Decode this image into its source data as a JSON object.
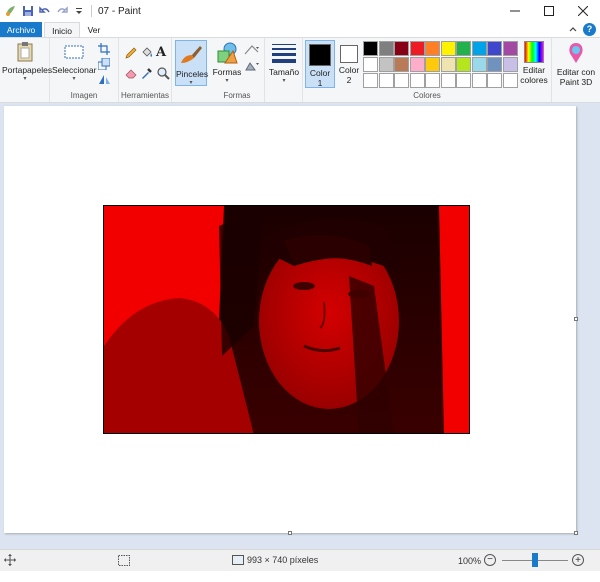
{
  "window": {
    "title": "07 - Paint"
  },
  "tabs": [
    {
      "label": "Archivo"
    },
    {
      "label": "Inicio"
    },
    {
      "label": "Ver"
    }
  ],
  "ribbon": {
    "portapapeles_label": "Portapapeles",
    "seleccionar_label": "Seleccionar",
    "imagen_group": "Imagen",
    "herramientas_group": "Herramientas",
    "pinceles_label": "Pinceles",
    "formas_label": "Formas",
    "formas_group": "Formas",
    "tamano_label": "Tamaño",
    "color1_label": "Color",
    "color1_num": "1",
    "color2_label": "Color",
    "color2_num": "2",
    "colores_group": "Colores",
    "editar_colores_1": "Editar",
    "editar_colores_2": "colores",
    "paint3d_1": "Editar con",
    "paint3d_2": "Paint 3D"
  },
  "colors": {
    "accent": "#1979ca",
    "color1": "#000000",
    "color2": "#ffffff",
    "palette_row1": [
      "#000000",
      "#7f7f7f",
      "#880015",
      "#ed1c24",
      "#ff7f27",
      "#fff200",
      "#22b14c",
      "#00a2e8",
      "#3f48cc",
      "#a349a4"
    ],
    "palette_row2": [
      "#ffffff",
      "#c3c3c3",
      "#b97a57",
      "#ffaec9",
      "#ffc90e",
      "#efe4b0",
      "#b5e61d",
      "#99d9ea",
      "#7092be",
      "#c8bfe7"
    ],
    "palette_row3": [
      "#ffffff",
      "#ffffff",
      "#ffffff",
      "#ffffff",
      "#ffffff",
      "#ffffff",
      "#ffffff",
      "#ffffff",
      "#ffffff",
      "#ffffff"
    ]
  },
  "status": {
    "dimensions": "993 × 740 píxeles",
    "zoom": "100%",
    "zoom_level_fraction": 0.5
  }
}
